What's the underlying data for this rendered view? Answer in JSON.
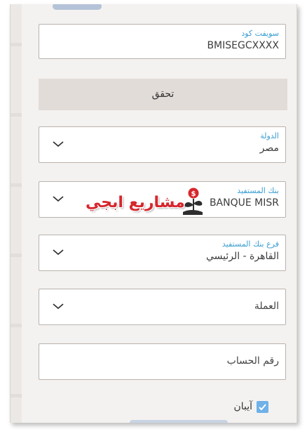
{
  "swift": {
    "label": "سويفت كود",
    "value": "BMISEGCXXXX"
  },
  "verify_button": {
    "label": "تحقق"
  },
  "country": {
    "label": "الدولة",
    "value": "مصر"
  },
  "bank": {
    "label": "بنك المستفيد",
    "value": "BANQUE MISR"
  },
  "branch": {
    "label": "فرع بنك المستفيد",
    "value": "القاهرة - الرئيسي"
  },
  "currency": {
    "placeholder": "العملة"
  },
  "account": {
    "placeholder": "رقم الحساب"
  },
  "iban": {
    "label": "آيبان",
    "checked": true
  },
  "watermark": {
    "text": "مشاريع ابجي"
  },
  "colors": {
    "label_blue": "#3a9ed2",
    "watermark_red": "#d6262c",
    "check_blue": "#6fb1e8"
  },
  "icons": [
    "chevron-down-icon",
    "check-icon",
    "money-plant-icon"
  ]
}
